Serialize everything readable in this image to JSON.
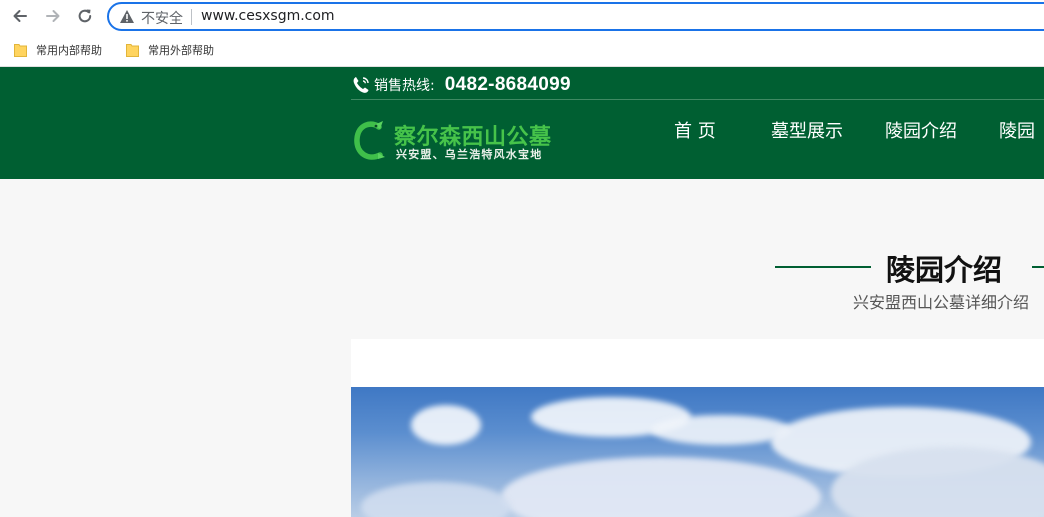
{
  "browser": {
    "insecure_label": "不安全",
    "url": "www.cesxsgm.com",
    "bookmarks": [
      {
        "label": "常用内部帮助",
        "icon": "folder-icon"
      },
      {
        "label": "常用外部帮助",
        "icon": "folder-icon"
      }
    ]
  },
  "header": {
    "hotline_label": "销售热线:",
    "hotline_number": "0482-8684099",
    "logo_title": "察尔森西山公墓",
    "logo_subtitle": "兴安盟、乌兰浩特风水宝地",
    "nav": [
      {
        "label": "首 页"
      },
      {
        "label": "墓型展示"
      },
      {
        "label": "陵园介绍"
      },
      {
        "label": "陵园"
      }
    ]
  },
  "section": {
    "title": "陵园介绍",
    "subtitle": "兴安盟西山公墓详细介绍"
  },
  "colors": {
    "header_bg": "#005f32",
    "accent_green": "#46c34a",
    "address_focus": "#1a73e8"
  }
}
